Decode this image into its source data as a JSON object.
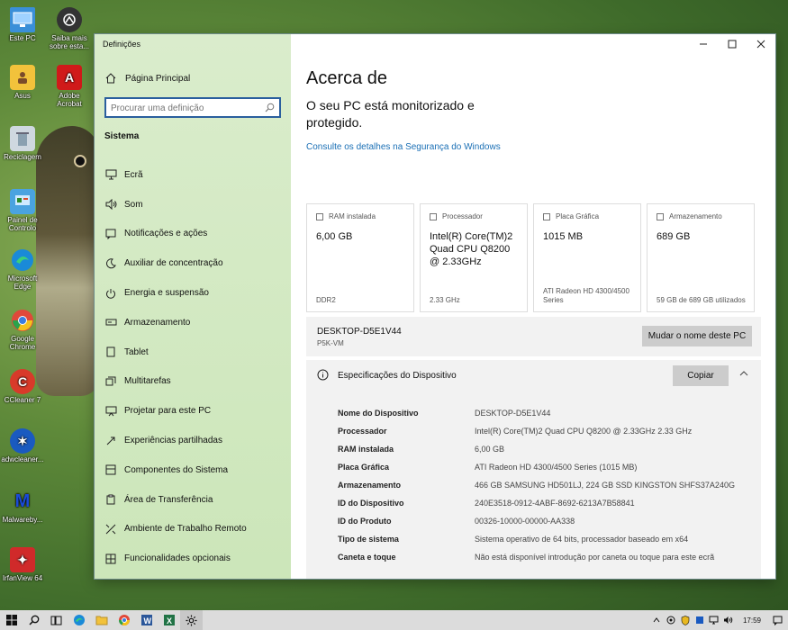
{
  "desktop": {
    "icons": [
      {
        "label": "Este PC"
      },
      {
        "label": "Saiba mais sobre esta..."
      },
      {
        "label": "Asus"
      },
      {
        "label": "Adobe Acrobat"
      },
      {
        "label": "Reciclagem"
      },
      {
        "label": "Painel de Controlo"
      },
      {
        "label": "Microsoft Edge"
      },
      {
        "label": "Google Chrome"
      },
      {
        "label": "CCleaner 7"
      },
      {
        "label": "adwcleaner..."
      },
      {
        "label": "Malwareby..."
      },
      {
        "label": "IrfanView 64"
      }
    ]
  },
  "window": {
    "title": "Definições",
    "home_label": "Página Principal",
    "search_placeholder": "Procurar uma definição",
    "section": "Sistema",
    "nav": [
      {
        "label": "Ecrã",
        "icon": "monitor-icon"
      },
      {
        "label": "Som",
        "icon": "speaker-icon"
      },
      {
        "label": "Notificações e ações",
        "icon": "notification-icon"
      },
      {
        "label": "Auxiliar de concentração",
        "icon": "moon-icon"
      },
      {
        "label": "Energia e suspensão",
        "icon": "power-icon"
      },
      {
        "label": "Armazenamento",
        "icon": "storage-icon"
      },
      {
        "label": "Tablet",
        "icon": "tablet-icon"
      },
      {
        "label": "Multitarefas",
        "icon": "multitask-icon"
      },
      {
        "label": "Projetar para este PC",
        "icon": "project-icon"
      },
      {
        "label": "Experiências partilhadas",
        "icon": "share-icon"
      },
      {
        "label": "Componentes do Sistema",
        "icon": "components-icon"
      },
      {
        "label": "Área de Transferência",
        "icon": "clipboard-icon"
      },
      {
        "label": "Ambiente de Trabalho Remoto",
        "icon": "remote-icon"
      },
      {
        "label": "Funcionalidades opcionais",
        "icon": "features-icon"
      }
    ]
  },
  "about": {
    "heading": "Acerca de",
    "protection": "O seu PC está monitorizado e protegido.",
    "security_link": "Consulte os detalhes na Segurança do Windows",
    "cards": [
      {
        "title": "RAM instalada",
        "value": "6,00 GB",
        "sub": "DDR2"
      },
      {
        "title": "Processador",
        "value": "Intel(R) Core(TM)2 Quad CPU Q8200 @ 2.33GHz",
        "sub": "2.33 GHz"
      },
      {
        "title": "Placa Gráfica",
        "value": "1015 MB",
        "sub": "ATI Radeon HD 4300/4500 Series"
      },
      {
        "title": "Armazenamento",
        "value": "689 GB",
        "sub": "59 GB de 689 GB utilizados"
      }
    ],
    "pc_name": "DESKTOP-D5E1V44",
    "pc_model": "P5K-VM",
    "rename_button": "Mudar o nome deste PC",
    "specs_title": "Especificações do Dispositivo",
    "copy_button": "Copiar",
    "specs": [
      {
        "k": "Nome do Dispositivo",
        "v": "DESKTOP-D5E1V44"
      },
      {
        "k": "Processador",
        "v": "Intel(R) Core(TM)2 Quad CPU Q8200 @ 2.33GHz 2.33 GHz"
      },
      {
        "k": "RAM instalada",
        "v": "6,00 GB"
      },
      {
        "k": "Placa Gráfica",
        "v": "ATI Radeon HD 4300/4500 Series (1015 MB)"
      },
      {
        "k": "Armazenamento",
        "v": "466 GB SAMSUNG HD501LJ, 224 GB SSD KINGSTON SHFS37A240G"
      },
      {
        "k": "ID do Dispositivo",
        "v": "240E3518-0912-4ABF-8692-6213A7B58841"
      },
      {
        "k": "ID do Produto",
        "v": "00326-10000-00000-AA338"
      },
      {
        "k": "Tipo de sistema",
        "v": "Sistema operativo de 64 bits, processador baseado em x64"
      },
      {
        "k": "Caneta e toque",
        "v": "Não está disponível introdução por caneta ou toque para este ecrã"
      }
    ]
  },
  "taskbar": {
    "clock": "17:59"
  }
}
